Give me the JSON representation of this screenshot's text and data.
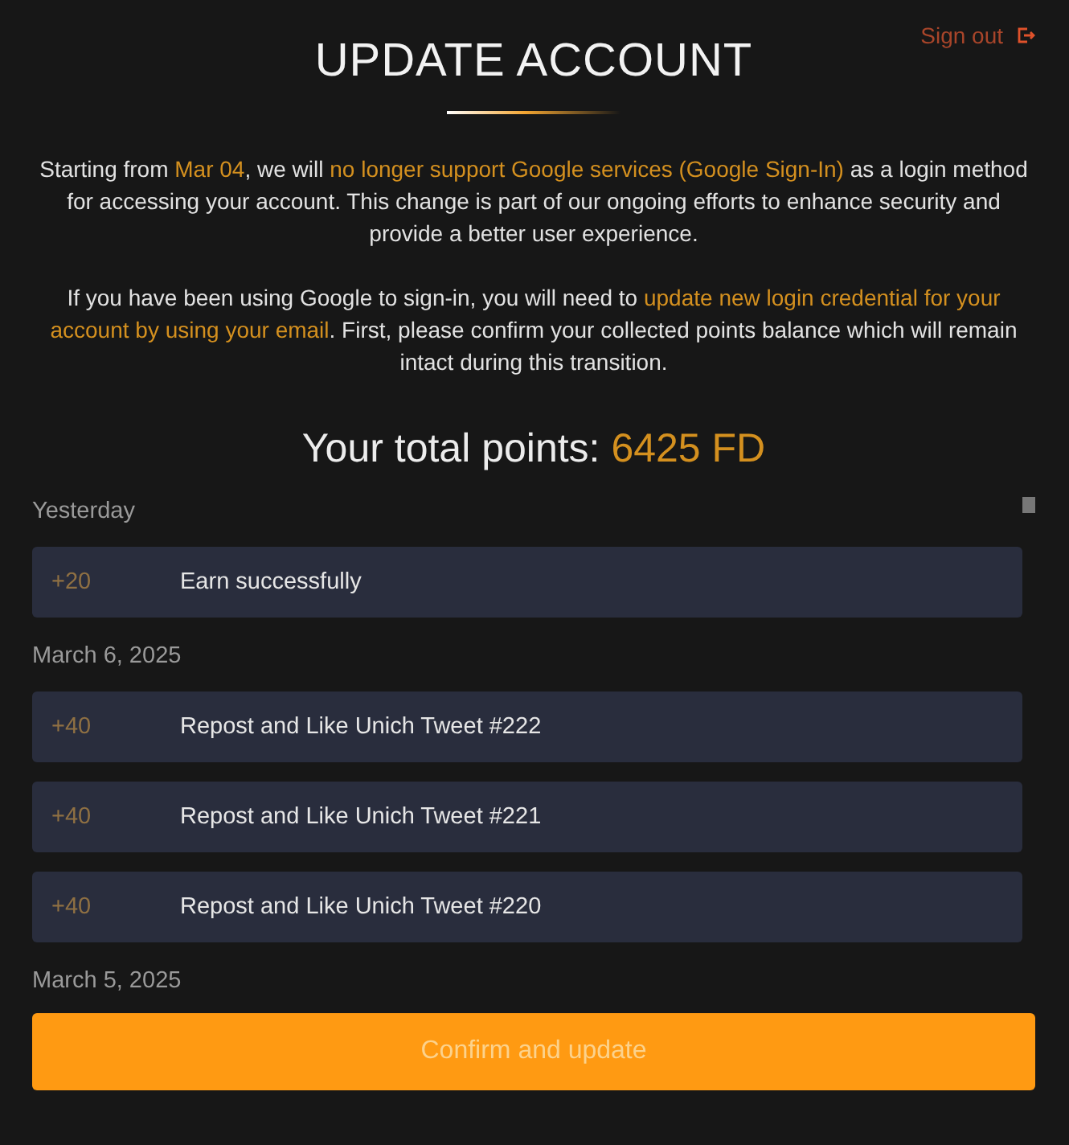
{
  "sign_out": {
    "label": "Sign out"
  },
  "title": "UPDATE ACCOUNT",
  "paragraphs": [
    "Starting from *Mar 04*, we will *no longer support Google services (Google Sign-In)* as a login method for accessing your account. This change is part of our ongoing efforts to enhance security and provide a better user experience.",
    "If you have been using Google to sign-in, you will need to *update new login credential for your account by using your email*. First, please confirm your collected points balance which will remain intact during this transition."
  ],
  "total": {
    "label": "Your total points:",
    "value": "6425 FD"
  },
  "history": [
    {
      "date": "Yesterday",
      "entries": [
        {
          "points": "+20",
          "description": "Earn successfully"
        }
      ]
    },
    {
      "date": "March 6, 2025",
      "entries": [
        {
          "points": "+40",
          "description": "Repost and Like Unich Tweet #222"
        },
        {
          "points": "+40",
          "description": "Repost and Like Unich Tweet #221"
        },
        {
          "points": "+40",
          "description": "Repost and Like Unich Tweet #220"
        }
      ]
    },
    {
      "date": "March 5, 2025"
    }
  ],
  "confirm_button": {
    "label": "Confirm and update",
    "disabled": true
  }
}
